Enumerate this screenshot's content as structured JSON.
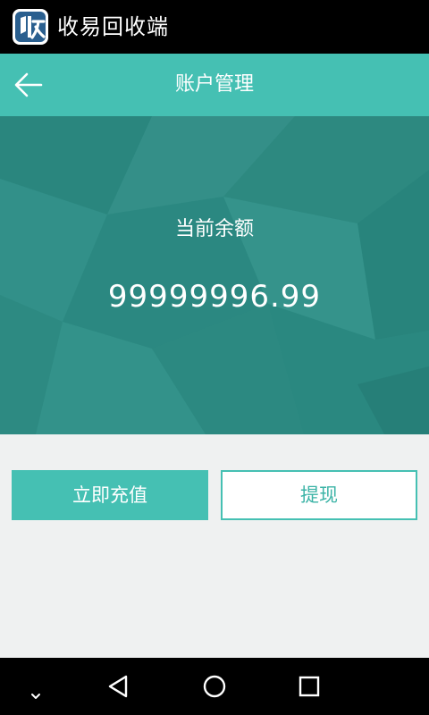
{
  "app": {
    "title": "收易回收端",
    "logo_icon": "shou-logo-icon"
  },
  "header": {
    "title": "账户管理",
    "back_icon": "arrow-left-icon"
  },
  "balance": {
    "label": "当前余额",
    "amount": "99999996.99"
  },
  "actions": {
    "recharge_label": "立即充值",
    "withdraw_label": "提现"
  },
  "nav": {
    "hide_icon": "chevron-down-icon",
    "back_icon": "triangle-back-icon",
    "home_icon": "circle-home-icon",
    "recent_icon": "square-recent-icon"
  },
  "colors": {
    "accent": "#45c0b3",
    "panel": "#2e8c84",
    "page_bg": "#eff1f1"
  }
}
